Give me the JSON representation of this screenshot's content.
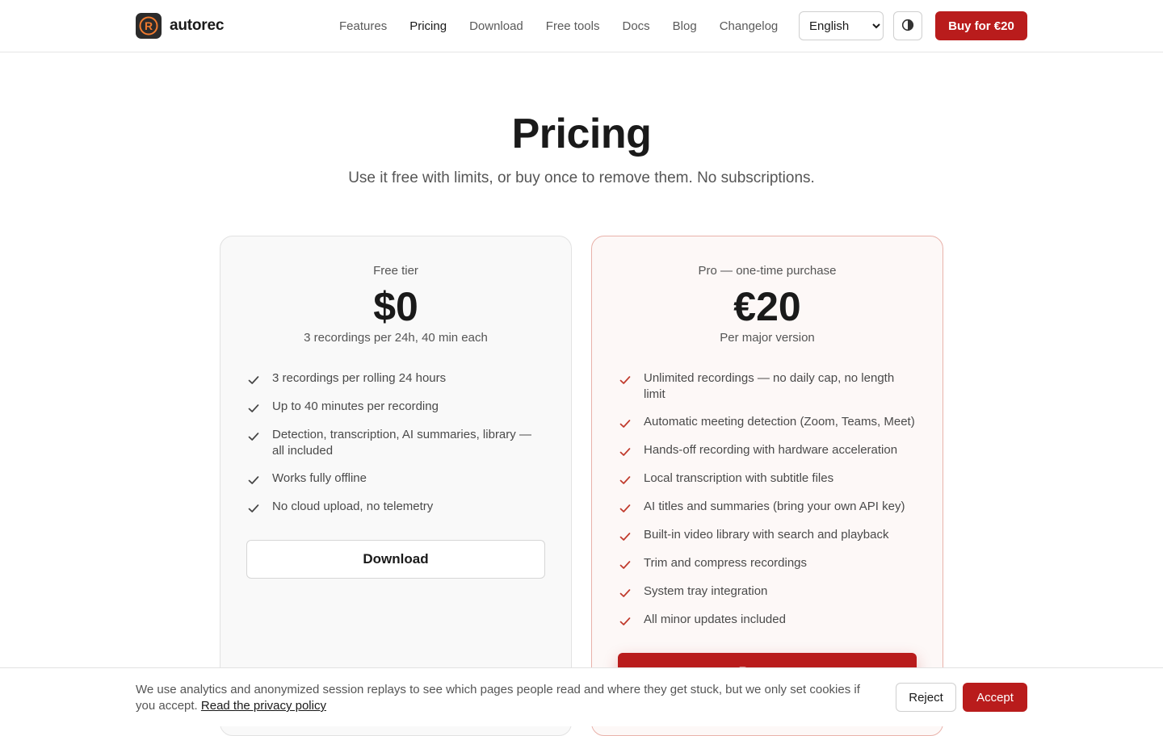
{
  "header": {
    "brand": "autorec",
    "logo_letter": "R",
    "nav": [
      "Features",
      "Pricing",
      "Download",
      "Free tools",
      "Docs",
      "Blog",
      "Changelog"
    ],
    "active_nav": "Pricing",
    "language": {
      "selected": "English",
      "options": [
        "English"
      ]
    },
    "theme_icon": "contrast-icon",
    "buy_label": "Buy for €20"
  },
  "hero": {
    "title": "Pricing",
    "subtitle": "Use it free with limits, or buy once to remove them. No subscriptions."
  },
  "plans": {
    "free": {
      "label": "Free tier",
      "price": "$0",
      "note": "3 recordings per 24h, 40 min each",
      "features": [
        "3 recordings per rolling 24 hours",
        "Up to 40 minutes per recording",
        "Detection, transcription, AI summaries, library — all included",
        "Works fully offline",
        "No cloud upload, no telemetry"
      ],
      "button": "Download"
    },
    "pro": {
      "label": "Pro — one-time purchase",
      "price": "€20",
      "note": "Per major version",
      "features": [
        "Unlimited recordings — no daily cap, no length limit",
        "Automatic meeting detection (Zoom, Teams, Meet)",
        "Hands-off recording with hardware acceleration",
        "Local transcription with subtitle files",
        "AI titles and summaries (bring your own API key)",
        "Built-in video library with search and playback",
        "Trim and compress recordings",
        "System tray integration",
        "All minor updates included"
      ],
      "button": "Buy now"
    }
  },
  "cookie": {
    "text": "We use analytics and anonymized session replays to see which pages people read and where they get stuck, but we only set cookies if you accept.",
    "link": "Read the privacy policy",
    "reject": "Reject",
    "accept": "Accept"
  },
  "colors": {
    "accent": "#b91c1c",
    "free_check": "#444444",
    "pro_check": "#c0392b"
  }
}
